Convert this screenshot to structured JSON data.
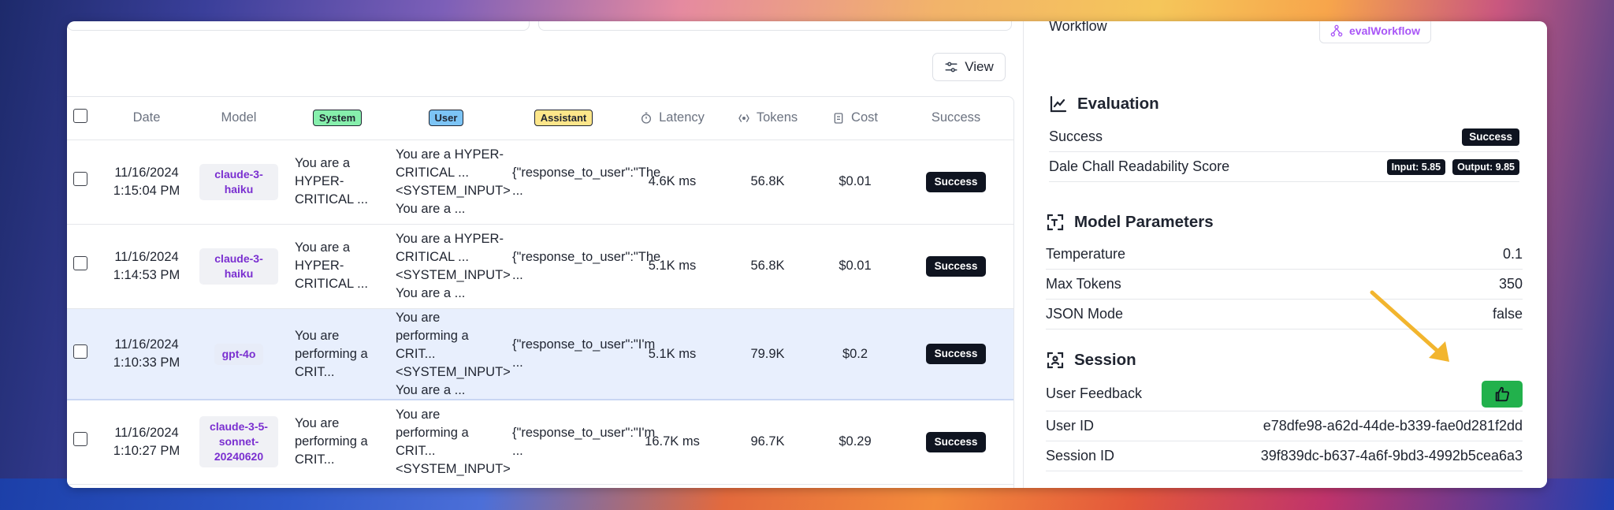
{
  "toolbar": {
    "view_label": "View"
  },
  "table": {
    "headers": {
      "date": "Date",
      "model": "Model",
      "system": "System",
      "user": "User",
      "assistant": "Assistant",
      "latency": "Latency",
      "tokens": "Tokens",
      "cost": "Cost",
      "success": "Success"
    },
    "rows": [
      {
        "date": "11/16/2024",
        "time": "1:15:04 PM",
        "model": "claude-3-haiku",
        "system": "You are a HYPER-CRITICAL ...",
        "user": "You are a HYPER-CRITICAL ... <SYSTEM_INPUT> You are a ...",
        "assistant": "{\"response_to_user\":\"The ...",
        "latency": "4.6K ms",
        "tokens": "56.8K",
        "cost": "$0.01",
        "status": "Success"
      },
      {
        "date": "11/16/2024",
        "time": "1:14:53 PM",
        "model": "claude-3-haiku",
        "system": "You are a HYPER-CRITICAL ...",
        "user": "You are a HYPER-CRITICAL ... <SYSTEM_INPUT> You are a ...",
        "assistant": "{\"response_to_user\":\"The ...",
        "latency": "5.1K ms",
        "tokens": "56.8K",
        "cost": "$0.01",
        "status": "Success"
      },
      {
        "date": "11/16/2024",
        "time": "1:10:33 PM",
        "model": "gpt-4o",
        "system": "You are performing a CRIT...",
        "user": "You are performing a CRIT... <SYSTEM_INPUT> You are a ...",
        "assistant": "{\"response_to_user\":\"I'm ...",
        "latency": "5.1K ms",
        "tokens": "79.9K",
        "cost": "$0.2",
        "status": "Success"
      },
      {
        "date": "11/16/2024",
        "time": "1:10:27 PM",
        "model": "claude-3-5-sonnet-20240620",
        "system": "You are performing a CRIT...",
        "user": "You are performing a CRIT... <SYSTEM_INPUT>",
        "assistant": "{\"response_to_user\":\"I'm ...",
        "latency": "16.7K ms",
        "tokens": "96.7K",
        "cost": "$0.29",
        "status": "Success"
      }
    ]
  },
  "details": {
    "workflow_label": "Workflow",
    "workflow_link": "evalWorkflow",
    "evaluation": {
      "title": "Evaluation",
      "success_label": "Success",
      "success_value": "Success",
      "dale_label": "Dale Chall Readability Score",
      "dale_input": "Input: 5.85",
      "dale_output": "Output: 9.85"
    },
    "model_params": {
      "title": "Model Parameters",
      "temperature_label": "Temperature",
      "temperature_value": "0.1",
      "max_tokens_label": "Max Tokens",
      "max_tokens_value": "350",
      "json_mode_label": "JSON Mode",
      "json_mode_value": "false"
    },
    "session": {
      "title": "Session",
      "feedback_label": "User Feedback",
      "user_id_label": "User ID",
      "user_id_value": "e78dfe98-a62d-44de-b339-fae0d281f2dd",
      "session_id_label": "Session ID",
      "session_id_value": "39f839dc-b637-4a6f-9bd3-4992b5cea6a3"
    }
  },
  "colors": {
    "success_badge": "#0f1420",
    "model_chip_text": "#7a2fd0",
    "feedback_green": "#22b14c",
    "arrow": "#f2b52e",
    "selected_row": "#e8effd"
  }
}
